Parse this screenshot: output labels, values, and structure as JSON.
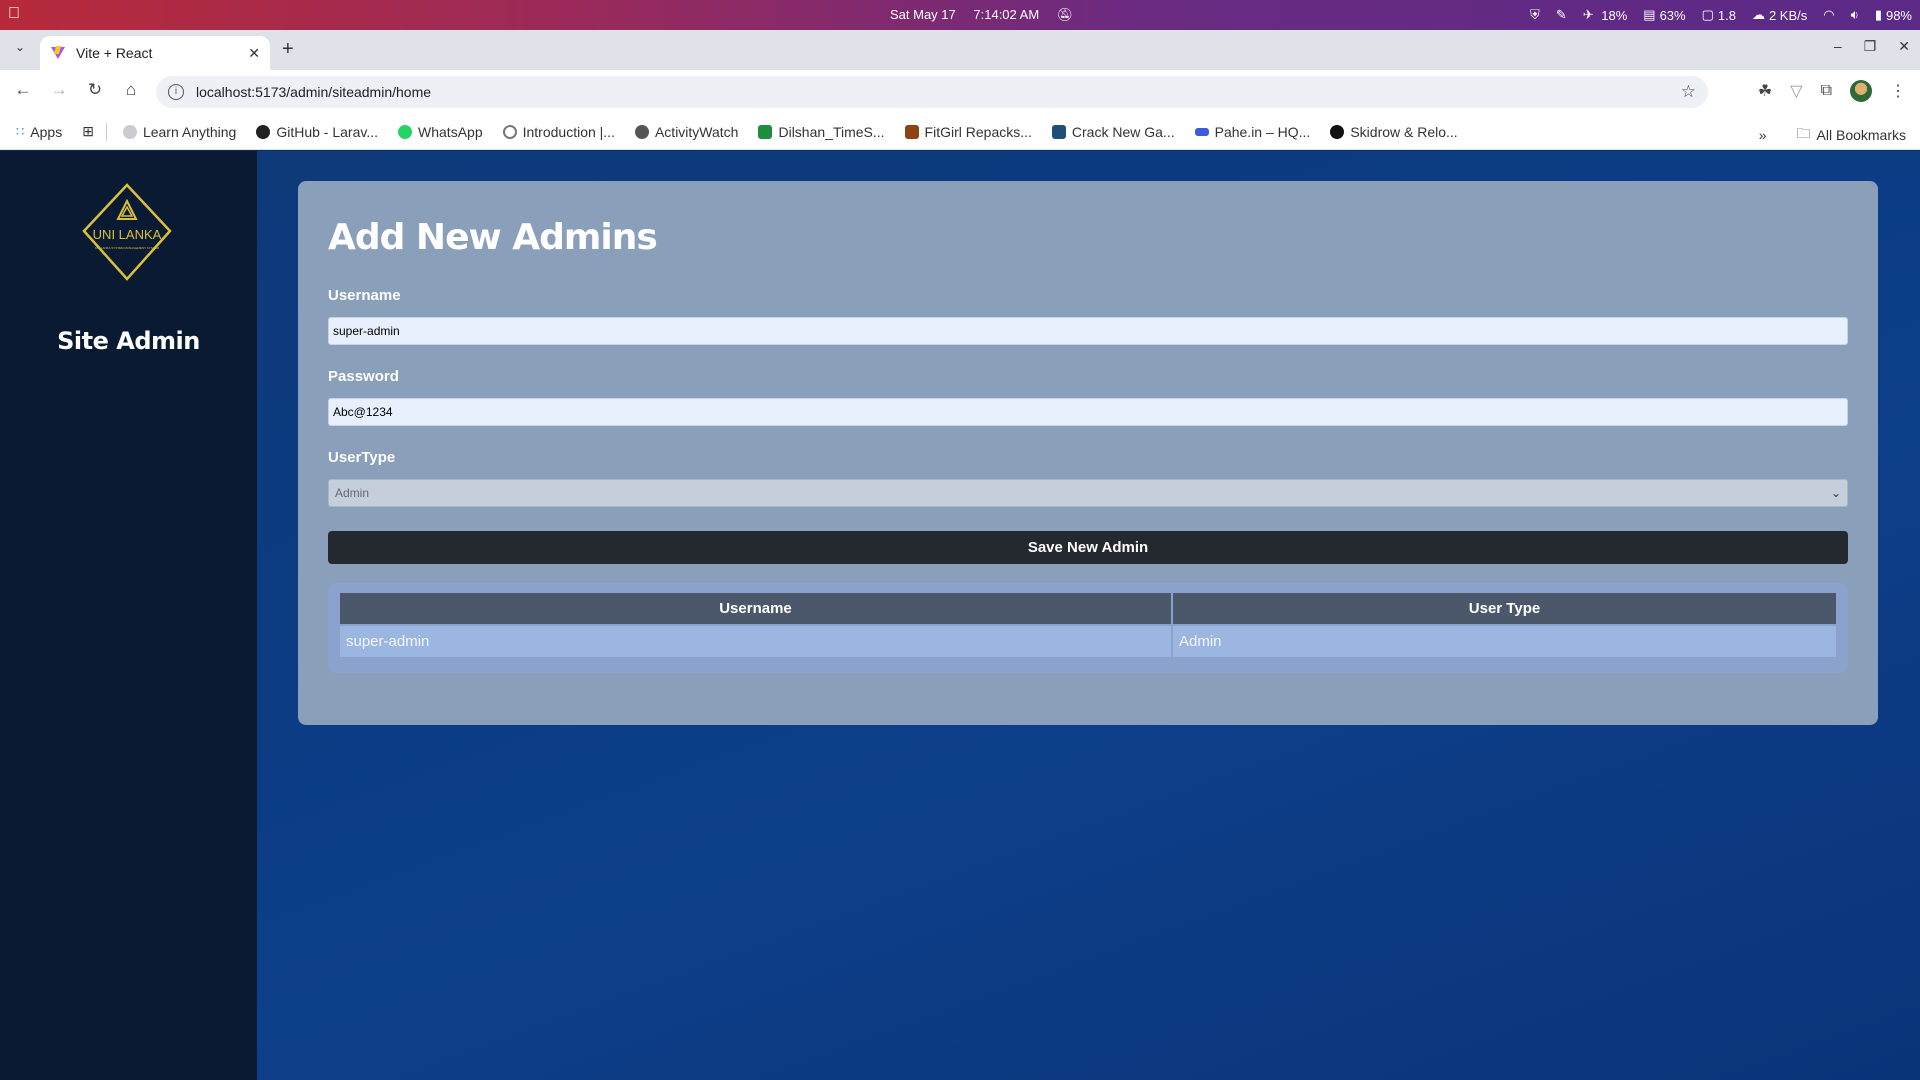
{
  "os": {
    "date": "Sat May 17",
    "time": "7:14:02 AM",
    "cpu": "18%",
    "mem": "63%",
    "load": "1.8",
    "net": "2 KB/s",
    "battery": "98%"
  },
  "browser": {
    "tab_title": "Vite + React",
    "url": "localhost:5173/admin/siteadmin/home",
    "bookmarks": [
      {
        "label": "Apps",
        "color": "#4285f4"
      },
      {
        "label": "Learn Anything",
        "color": "#9aa0a6"
      },
      {
        "label": "GitHub - Larav...",
        "color": "#222222"
      },
      {
        "label": "WhatsApp",
        "color": "#25d366"
      },
      {
        "label": "Introduction |...",
        "color": "#7f8c8d"
      },
      {
        "label": "ActivityWatch",
        "color": "#555555"
      },
      {
        "label": "Dilshan_TimeS...",
        "color": "#1e8e3e"
      },
      {
        "label": "FitGirl Repacks...",
        "color": "#8b4513"
      },
      {
        "label": "Crack New Ga...",
        "color": "#1f4e79"
      },
      {
        "label": "Pahe.in – HQ...",
        "color": "#3b5bdb"
      },
      {
        "label": "Skidrow & Relo...",
        "color": "#111111"
      }
    ],
    "all_bookmarks": "All Bookmarks"
  },
  "sidebar": {
    "logo_text": "UNI LANKA",
    "logo_sub": "UNI LANKA SYSTEM MANAGEMENT SYSTEM",
    "title": "Site Admin"
  },
  "form": {
    "heading": "Add New Admins",
    "username_label": "Username",
    "username_value": "super-admin",
    "password_label": "Password",
    "password_value": "Abc@1234",
    "usertype_label": "UserType",
    "usertype_value": "Admin",
    "save_label": "Save New Admin"
  },
  "table": {
    "headers": [
      "Username",
      "User Type"
    ],
    "rows": [
      [
        "super-admin",
        "Admin"
      ]
    ]
  }
}
